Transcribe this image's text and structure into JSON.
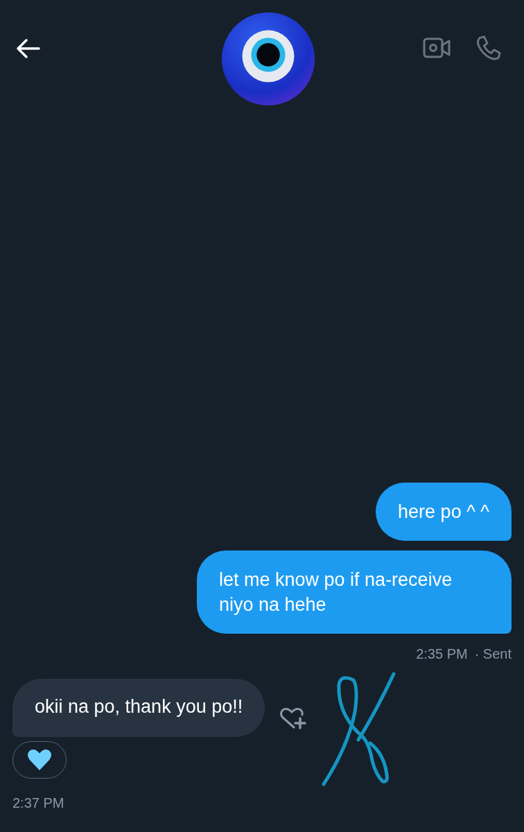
{
  "messages": [
    {
      "kind": "sent",
      "text": "here po ^ ^"
    },
    {
      "kind": "sent",
      "text": "let me know po if na-receive niyo na hehe"
    },
    {
      "kind": "meta_sent",
      "time": "2:35 PM",
      "status": "· Sent"
    },
    {
      "kind": "received",
      "text": "okii na po, thank you po!!",
      "reacted": true
    },
    {
      "kind": "meta_received",
      "time": "2:37 PM"
    }
  ]
}
